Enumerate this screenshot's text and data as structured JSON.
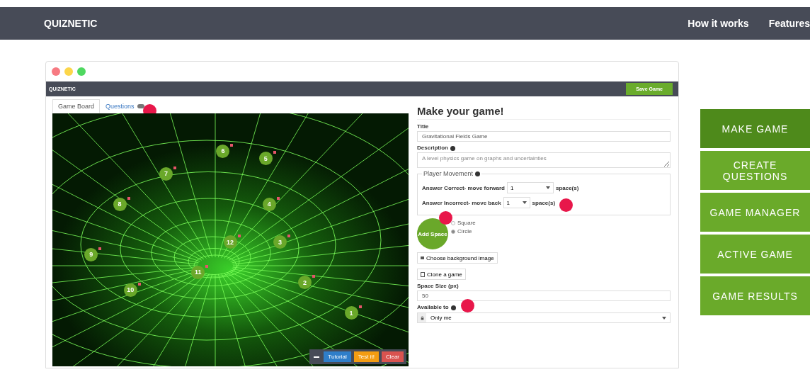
{
  "site_nav": {
    "brand": "QUIZNETIC",
    "links": [
      "How it works",
      "Features"
    ]
  },
  "app_window": {
    "app_title": "QUIZNETIC",
    "save_button": "Save Game",
    "tabs": [
      {
        "label": "Game Board",
        "selected": true
      },
      {
        "label": "Questions",
        "selected": false
      }
    ],
    "board": {
      "spaces": [
        {
          "label": "1"
        },
        {
          "label": "2"
        },
        {
          "label": "3"
        },
        {
          "label": "4"
        },
        {
          "label": "5"
        },
        {
          "label": "6"
        },
        {
          "label": "7"
        },
        {
          "label": "8"
        },
        {
          "label": "9"
        },
        {
          "label": "10"
        },
        {
          "label": "11"
        },
        {
          "label": "12"
        }
      ],
      "toolbar": [
        {
          "label": "Tutorial",
          "kind": "info"
        },
        {
          "label": "Test it!",
          "kind": "warning"
        },
        {
          "label": "Clear",
          "kind": "danger"
        }
      ]
    },
    "form": {
      "heading": "Make your game!",
      "title_label": "Title",
      "title_value": "Gravitational Fields Game",
      "description_label": "Description",
      "description_placeholder": "A level physics game on graphs and uncertainties",
      "movement_legend": "Player Movement",
      "movement_rows": [
        {
          "label": "Answer Correct- move forward",
          "value": "1",
          "unit": "space(s)"
        },
        {
          "label": "Answer Incorrect- move back",
          "value": "1",
          "unit": "space(s)"
        }
      ],
      "add_space_button": "Add Space",
      "shapes": [
        {
          "label": "Square",
          "selected": false
        },
        {
          "label": "Circle",
          "selected": true
        }
      ],
      "background_button": "Choose background image",
      "clone_button": "Clone a game",
      "size_label": "Space Size (px)",
      "size_value": "50",
      "available_label": "Available to",
      "available_value": "Only me"
    }
  },
  "side_menu": [
    {
      "label": "MAKE GAME",
      "selected": true
    },
    {
      "label": "CREATE QUESTIONS",
      "selected": false
    },
    {
      "label": "GAME MANAGER",
      "selected": false
    },
    {
      "label": "ACTIVE GAME",
      "selected": false
    },
    {
      "label": "GAME RESULTS",
      "selected": false
    }
  ]
}
